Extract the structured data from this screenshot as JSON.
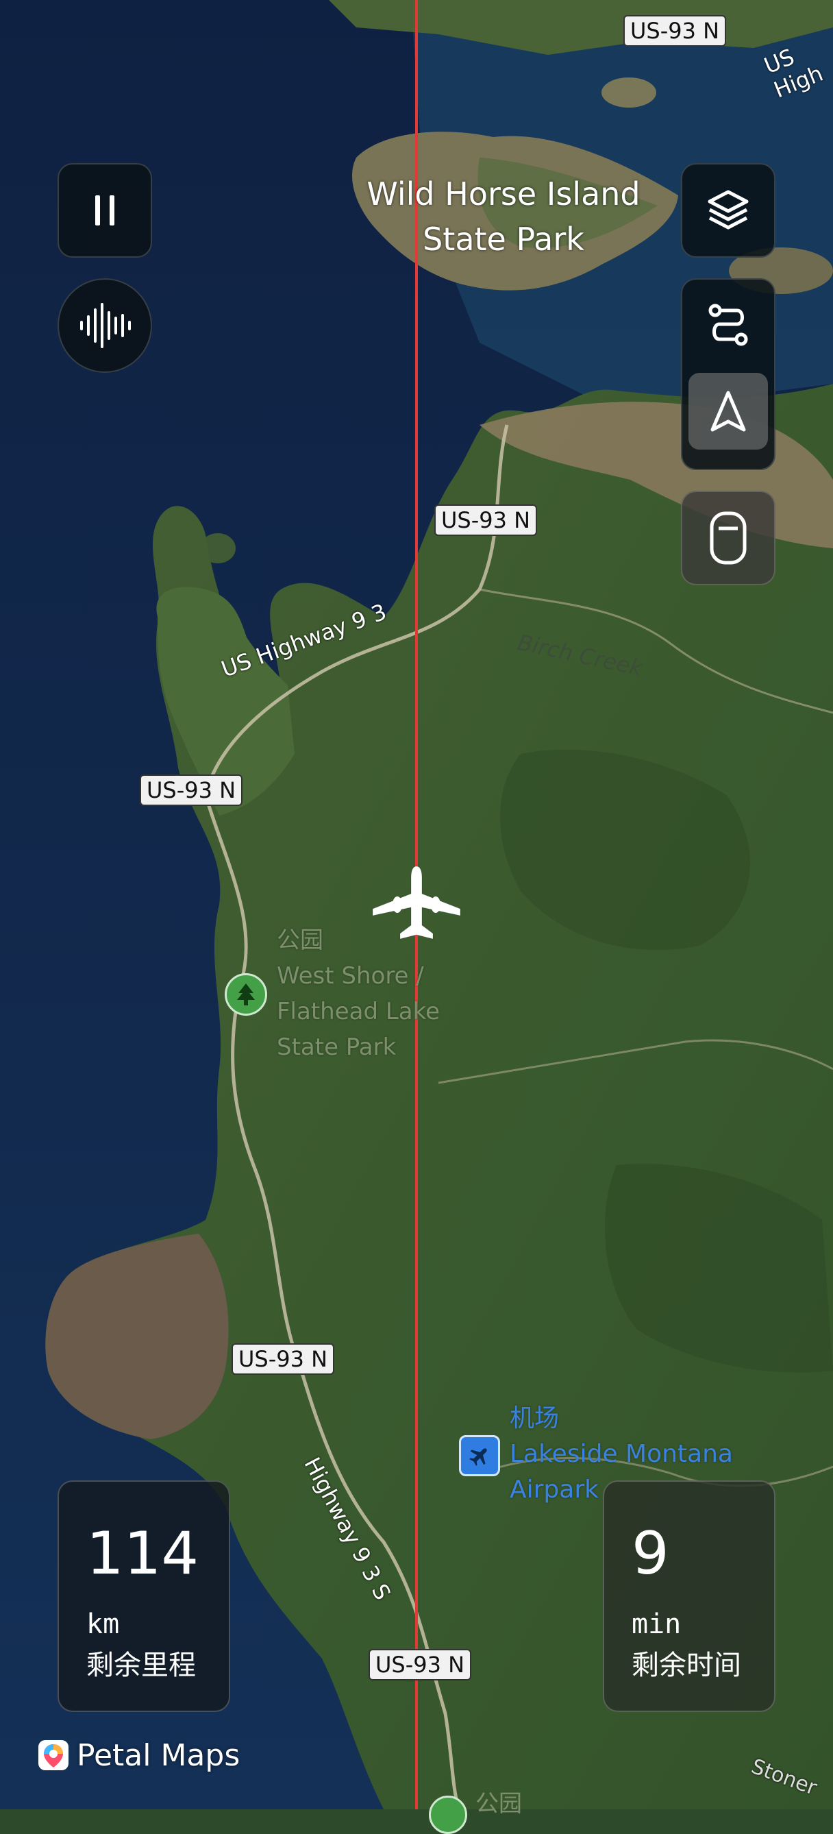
{
  "map": {
    "road_shields": [
      "US-93 N",
      "US-93 N",
      "US-93 N",
      "US-93 N",
      "US-93 N"
    ],
    "road_names": [
      "US Highway 9 3",
      "Highway 9 3 S",
      "US High",
      "Stoner"
    ],
    "creek_label": "Birch Creek",
    "island_label_line1": "Wild Horse Island",
    "island_label_line2": "State Park",
    "park_poi": {
      "category": "公园",
      "name_line1": "West Shore /",
      "name_line2": "Flathead Lake",
      "name_line3": "State Park"
    },
    "airport_poi": {
      "category": "机场",
      "name_line1": "Lakeside Montana",
      "name_line2": "Airpark"
    },
    "bottom_poi_category": "公园",
    "route_color": "#e53935"
  },
  "controls": {
    "pause_icon": "pause-icon",
    "voice_icon": "sound-wave-icon",
    "layers_icon": "layers-icon",
    "route_icon": "route-icon",
    "navigate_icon": "navigation-arrow-icon",
    "device_icon": "phone-orientation-icon"
  },
  "stats": {
    "distance_value": "114",
    "distance_unit": "km",
    "distance_label": "剩余里程",
    "time_value": "9",
    "time_unit": "min",
    "time_label": "剩余时间"
  },
  "branding": {
    "name": "Petal Maps"
  },
  "colors": {
    "water": "#14294a",
    "land": "#3c5a2e",
    "route": "#e53935",
    "poi_park": "#43a047",
    "poi_airport": "#2f7de1"
  }
}
